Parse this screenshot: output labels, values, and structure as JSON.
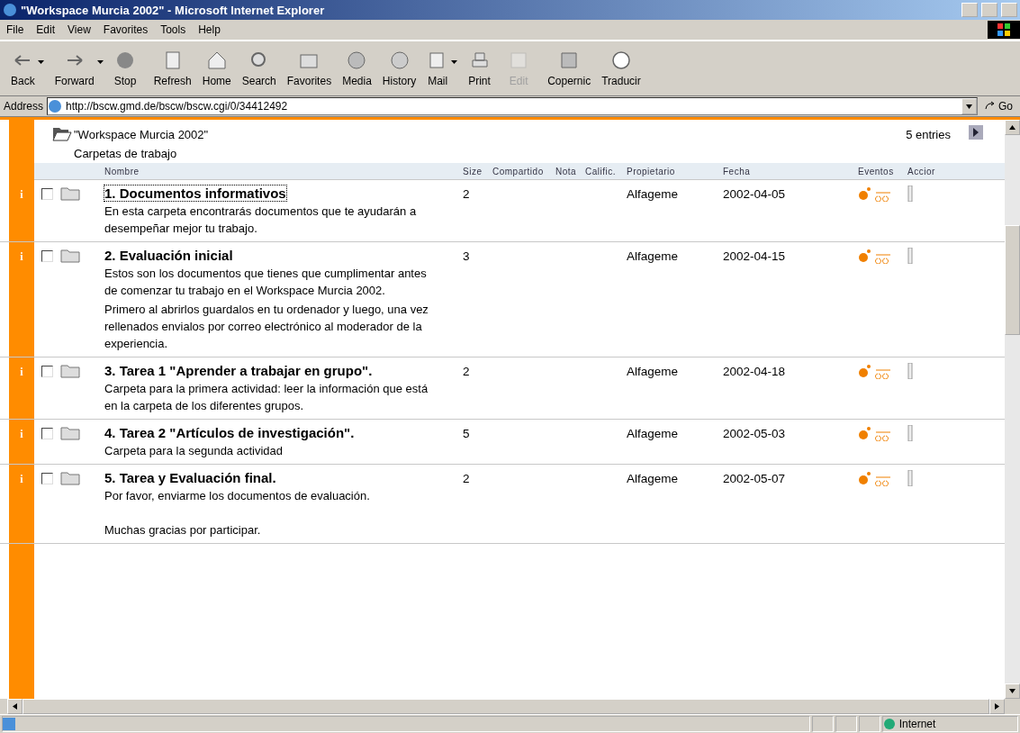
{
  "window": {
    "title": "\"Workspace Murcia 2002\" - Microsoft Internet Explorer"
  },
  "menu": [
    "File",
    "Edit",
    "View",
    "Favorites",
    "Tools",
    "Help"
  ],
  "toolbar": [
    {
      "label": "Back",
      "kind": "back",
      "disabled": false,
      "dropdown": true
    },
    {
      "label": "Forward",
      "kind": "forward",
      "disabled": false,
      "dropdown": true
    },
    {
      "label": "Stop",
      "kind": "stop",
      "disabled": false,
      "dropdown": false
    },
    {
      "label": "Refresh",
      "kind": "refresh",
      "disabled": false,
      "dropdown": false
    },
    {
      "label": "Home",
      "kind": "home",
      "disabled": false,
      "dropdown": false
    },
    {
      "label": "Search",
      "kind": "search",
      "disabled": false,
      "dropdown": false
    },
    {
      "label": "Favorites",
      "kind": "favorites",
      "disabled": false,
      "dropdown": false
    },
    {
      "label": "Media",
      "kind": "media",
      "disabled": false,
      "dropdown": false
    },
    {
      "label": "History",
      "kind": "history",
      "disabled": false,
      "dropdown": false
    },
    {
      "label": "Mail",
      "kind": "mail",
      "disabled": false,
      "dropdown": true
    },
    {
      "label": "Print",
      "kind": "print",
      "disabled": false,
      "dropdown": false
    },
    {
      "label": "Edit",
      "kind": "edit",
      "disabled": true,
      "dropdown": false
    },
    {
      "label": "Copernic",
      "kind": "copernic",
      "disabled": false,
      "dropdown": false
    },
    {
      "label": "Traducir",
      "kind": "translate",
      "disabled": false,
      "dropdown": false
    }
  ],
  "address": {
    "label": "Address",
    "value": "http://bscw.gmd.de/bscw/bscw.cgi/0/34412492",
    "go": "Go"
  },
  "folder": {
    "title": "\"Workspace Murcia 2002\"",
    "subtitle": "Carpetas de trabajo",
    "count": "5 entries"
  },
  "columns": [
    "Nombre",
    "Size",
    "Compartido",
    "Nota",
    "Calific.",
    "Propietario",
    "Fecha",
    "Eventos",
    "Accior"
  ],
  "rows": [
    {
      "info": "i",
      "checked": false,
      "name": "1. Documentos informativos",
      "focused": true,
      "description": [
        "En esta carpeta encontrarás documentos que te ayudarán a desempeñar mejor tu trabajo."
      ],
      "size": "2",
      "owner": "Alfageme",
      "date": "2002-04-05"
    },
    {
      "info": "i",
      "checked": false,
      "name": "2. Evaluación inicial",
      "focused": false,
      "description": [
        "Estos son los documentos que tienes que cumplimentar antes de comenzar tu trabajo en el Workspace Murcia 2002.",
        "Primero al abrirlos guardalos en tu ordenador y luego, una vez rellenados envialos por correo electrónico al moderador de la experiencia."
      ],
      "size": "3",
      "owner": "Alfageme",
      "date": "2002-04-15"
    },
    {
      "info": "i",
      "checked": false,
      "name": "3. Tarea 1 \"Aprender a trabajar en grupo\".",
      "focused": false,
      "description": [
        "Carpeta para la primera actividad: leer la información que está en la carpeta de los diferentes grupos."
      ],
      "size": "2",
      "owner": "Alfageme",
      "date": "2002-04-18"
    },
    {
      "info": "i",
      "checked": false,
      "name": "4. Tarea 2 \"Artículos de investigación\".",
      "focused": false,
      "description": [
        "Carpeta para la segunda actividad"
      ],
      "size": "5",
      "owner": "Alfageme",
      "date": "2002-05-03"
    },
    {
      "info": "i",
      "checked": false,
      "name": "5. Tarea y Evaluación final.",
      "focused": false,
      "description": [
        "Por favor, enviarme los documentos de evaluación."
      ],
      "note": "Muchas gracias por participar.",
      "size": "2",
      "owner": "Alfageme",
      "date": "2002-05-07"
    }
  ],
  "status_bar": {
    "zone": "Internet"
  }
}
